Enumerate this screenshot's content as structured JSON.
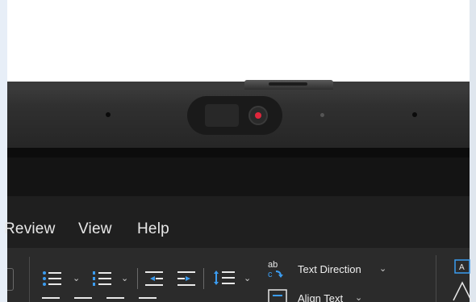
{
  "ribbon": {
    "tabs": [
      {
        "label": "Review"
      },
      {
        "label": "View"
      },
      {
        "label": "Help"
      }
    ],
    "paragraph": {
      "text_direction_label": "Text Direction",
      "align_text_label": "Align Text",
      "chevron": "⌄"
    }
  },
  "colors": {
    "accent": "#3b9cf0",
    "camera_led": "#e0263c",
    "ribbon_bg": "#2b2b2b",
    "tabbar_bg": "#1f1f1f"
  },
  "icons": {
    "bullets": "bullets-icon",
    "numbering": "numbering-icon",
    "decrease_indent": "decrease-indent-icon",
    "increase_indent": "increase-indent-icon",
    "line_spacing": "line-spacing-icon",
    "text_direction": "text-direction-icon",
    "align_text": "align-text-icon",
    "shape": "shape-icon"
  }
}
